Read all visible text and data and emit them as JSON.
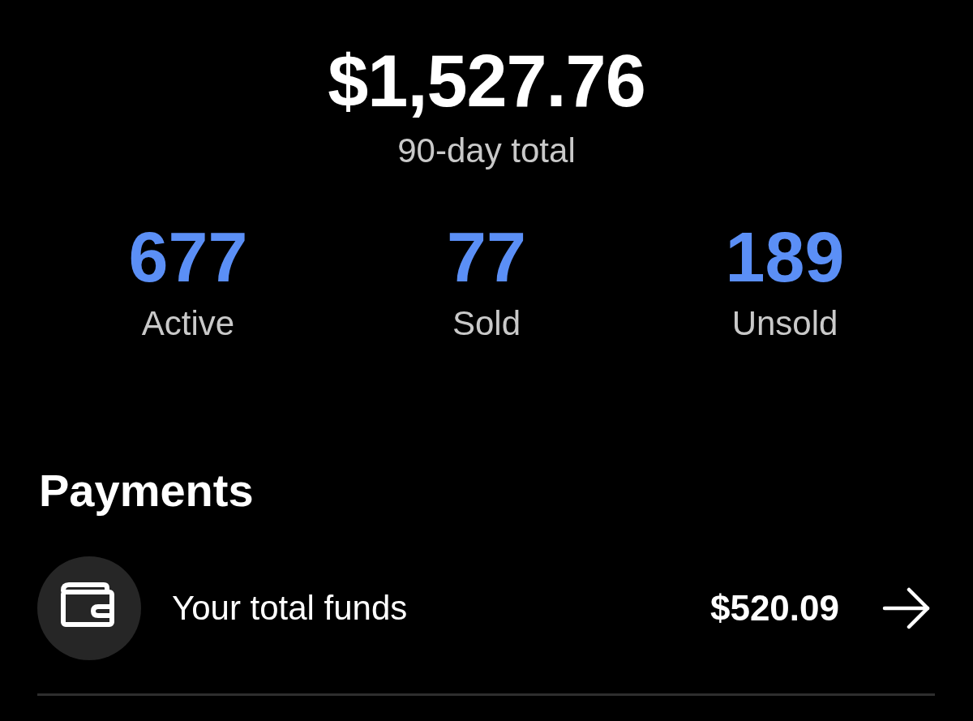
{
  "summary": {
    "total": "$1,527.76",
    "caption": "90-day total"
  },
  "stats": [
    {
      "value": "677",
      "label": "Active"
    },
    {
      "value": "77",
      "label": "Sold"
    },
    {
      "value": "189",
      "label": "Unsold"
    }
  ],
  "payments": {
    "title": "Payments",
    "rows": [
      {
        "kind": "wallet",
        "label": "Your total funds",
        "amount": "$520.09"
      }
    ]
  }
}
